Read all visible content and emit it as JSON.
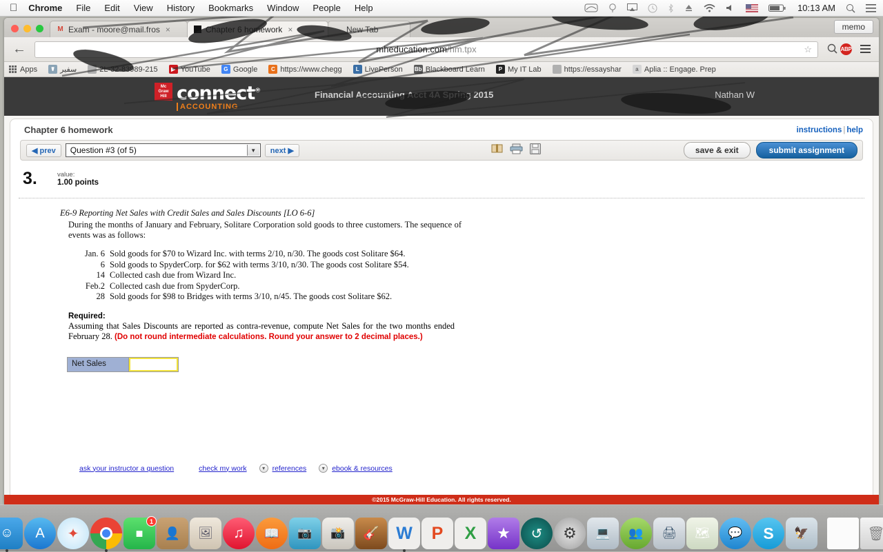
{
  "menubar": {
    "apple_icon": "apple-icon",
    "items": [
      "Chrome",
      "File",
      "Edit",
      "View",
      "History",
      "Bookmarks",
      "Window",
      "People",
      "Help"
    ],
    "status_icons": [
      "trackpad-icon",
      "siri-icon",
      "airplay-icon",
      "time-machine-icon",
      "bluetooth-icon",
      "eject-icon",
      "wifi-icon",
      "volume-icon",
      "flag-us-icon",
      "battery-icon"
    ],
    "clock": "10:13 AM",
    "search_icon": "search-icon",
    "notification_icon": "notification-center-icon"
  },
  "browser": {
    "tabs": [
      {
        "label": "Exam - moore@mail.fros",
        "favicon": "gmail-icon",
        "active": false,
        "close": "×"
      },
      {
        "label": "Chapter 6 homework",
        "favicon": "connect-icon",
        "active": true,
        "close": "×"
      },
      {
        "label": "New Tab",
        "favicon": "newtab-icon",
        "active": false,
        "close": ""
      }
    ],
    "memo_button": "memo",
    "back_icon": "back-arrow-icon",
    "url_host": "mheducation.com",
    "url_path": "/hm.tpx",
    "star_icon": "bookmark-star-icon",
    "zoom_icon": "search-icon",
    "adblock_label": "ABP",
    "menu_icon": "hamburger-menu-icon",
    "bookmarks": [
      {
        "label": "Apps",
        "icon": "apps-grid-icon",
        "color": ""
      },
      {
        "label": "سفير",
        "icon": "caduceus-icon",
        "color": "#8aa3b5"
      },
      {
        "label": "2L-32-83989-215",
        "icon": "page-icon",
        "color": "#b0b0b0"
      },
      {
        "label": "YouTube",
        "icon": "youtube-icon",
        "color": "#cc181e"
      },
      {
        "label": "Google",
        "icon": "google-icon",
        "color": "#4285f4"
      },
      {
        "label": "https://www.chegg",
        "icon": "chegg-icon",
        "color": "#e8701a"
      },
      {
        "label": "LivePerson",
        "icon": "liveperson-icon",
        "color": "#3a6ea5"
      },
      {
        "label": "Blackboard Learn",
        "icon": "blackboard-icon",
        "color": "#5a5a5a"
      },
      {
        "label": "My IT Lab",
        "icon": "pearson-icon",
        "color": "#222222"
      },
      {
        "label": "https://essayshar",
        "icon": "page-icon",
        "color": "#b0b0b0"
      },
      {
        "label": "Aplia :: Engage. Prep",
        "icon": "aplia-icon",
        "color": "#cccccc"
      }
    ]
  },
  "masthead": {
    "brand_box": "McGraw Hill Education",
    "brand_word": "connect",
    "brand_sup": "®",
    "brand_sub": "ACCOUNTING",
    "course": "Financial Accounting Acct 4A Spring 2015",
    "user": "Nathan W"
  },
  "page": {
    "assignment_title": "Chapter 6 homework",
    "instructions_link": "instructions",
    "help_link": "help",
    "separator": "|"
  },
  "toolbar": {
    "prev_label": "◀ prev",
    "question_selector": "Question #3 (of 5)",
    "dropdown_icon": "chevron-down-icon",
    "next_label": "next ▶",
    "icons": [
      "ebook-icon",
      "print-icon",
      "save-icon"
    ],
    "save_exit_label": "save & exit",
    "submit_label": "submit assignment"
  },
  "question": {
    "number": "3.",
    "value_label": "value:",
    "points": "1.00 points",
    "exercise_title": "E6-9 Reporting Net Sales with Credit Sales and Sales Discounts [LO 6-6]",
    "intro": "During the months of January and February, Solitare Corporation sold goods to three customers. The sequence of events was as follows:",
    "events": [
      {
        "date": "Jan. 6",
        "text": "Sold goods for $70 to Wizard Inc. with terms 2/10, n/30. The goods cost Solitare $64."
      },
      {
        "date": "6",
        "text": "Sold goods to SpyderCorp. for $62 with terms 3/10, n/30. The goods cost Solitare $54."
      },
      {
        "date": "14",
        "text": "Collected cash due from Wizard Inc."
      },
      {
        "date": "Feb.2",
        "text": "Collected cash due from SpyderCorp."
      },
      {
        "date": "28",
        "text": "Sold goods for $98 to Bridges with terms 3/10, n/45. The goods cost Solitare $62."
      }
    ],
    "required_label": "Required:",
    "required_text": "Assuming that Sales Discounts are reported as contra-revenue, compute Net Sales for the two months ended February 28. ",
    "required_note": "(Do not round intermediate calculations. Round your answer to 2 decimal places.)",
    "answer_row_label": "Net Sales",
    "answer_value": "",
    "answer_placeholder": ""
  },
  "footer_links": {
    "ask_instructor": "ask your instructor a question",
    "check_my_work": "check my work",
    "references": "references",
    "ebook_resources": "ebook & resources",
    "chevron_icon": "chevron-double-down-icon"
  },
  "copyright": "©2015 McGraw-Hill Education. All rights reserved.",
  "dock": {
    "items": [
      {
        "name": "finder",
        "glyph": "🙂",
        "bg": "#3aa0e8",
        "running": true
      },
      {
        "name": "app-store",
        "glyph": "A",
        "bg": "#2b8fe0",
        "running": false
      },
      {
        "name": "safari",
        "glyph": "⌘",
        "bg": "#d8eefb",
        "running": false
      },
      {
        "name": "chrome",
        "glyph": "",
        "bg": "#ffffff",
        "running": true
      },
      {
        "name": "facetime",
        "glyph": "▶",
        "bg": "#4cd964",
        "running": false,
        "badge": "1"
      },
      {
        "name": "contacts",
        "glyph": "👤",
        "bg": "#c8a06a",
        "running": false
      },
      {
        "name": "preview",
        "glyph": "🖼",
        "bg": "#e6ddd0",
        "running": false
      },
      {
        "name": "itunes",
        "glyph": "♪",
        "bg": "#f6354e",
        "running": false
      },
      {
        "name": "ibooks",
        "glyph": "📖",
        "bg": "#f5832a",
        "running": false
      },
      {
        "name": "photo-booth",
        "glyph": "📷",
        "bg": "#4fb9d8",
        "running": false
      },
      {
        "name": "iphoto",
        "glyph": "📸",
        "bg": "#d9d9d9",
        "running": false
      },
      {
        "name": "garageband",
        "glyph": "🎸",
        "bg": "#a06b3a",
        "running": false
      },
      {
        "name": "microsoft-word",
        "glyph": "W",
        "bg": "#e9e9e9",
        "running": true
      },
      {
        "name": "microsoft-powerpoint",
        "glyph": "P",
        "bg": "#e9e9e9",
        "running": false
      },
      {
        "name": "microsoft-excel",
        "glyph": "X",
        "bg": "#e9e9e9",
        "running": false
      },
      {
        "name": "imovie",
        "glyph": "★",
        "bg": "#8e4fd0",
        "running": false
      },
      {
        "name": "time-machine",
        "glyph": "↺",
        "bg": "#12605e",
        "running": false
      },
      {
        "name": "system-preferences",
        "glyph": "⚙",
        "bg": "#c9c9c9",
        "running": false
      },
      {
        "name": "remote-desktop",
        "glyph": "🖥",
        "bg": "#c4ccd4",
        "running": false
      },
      {
        "name": "messenger",
        "glyph": "👥",
        "bg": "#7ec242",
        "running": false
      },
      {
        "name": "hp-utility",
        "glyph": "🖨",
        "bg": "#d2d6da",
        "running": false
      },
      {
        "name": "maps",
        "glyph": "🗺",
        "bg": "#e4eadd",
        "running": false
      },
      {
        "name": "messages",
        "glyph": "💬",
        "bg": "#3ea8e8",
        "running": false
      },
      {
        "name": "skype",
        "glyph": "S",
        "bg": "#2bb2e8",
        "running": false
      },
      {
        "name": "mail-preview",
        "glyph": "🦅",
        "bg": "#cfd8e0",
        "running": false
      }
    ],
    "separator": "dock-separator",
    "stack_document": "document-stack-icon",
    "trash": "trash-icon"
  }
}
